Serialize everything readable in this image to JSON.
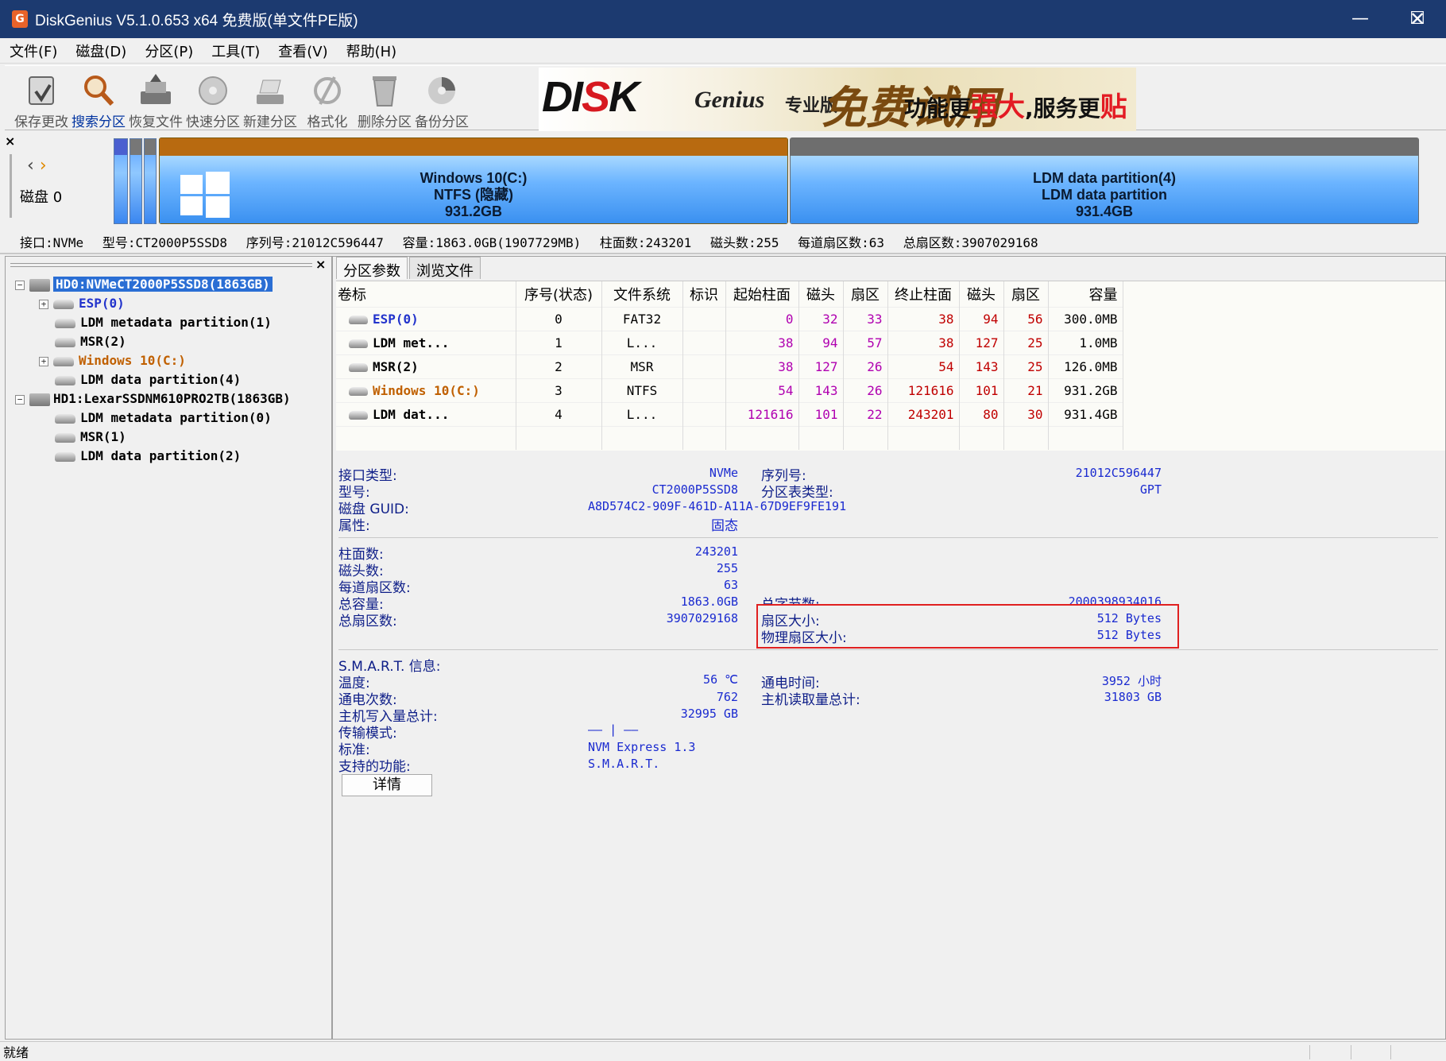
{
  "window": {
    "title": "DiskGenius V5.1.0.653 x64 免费版(单文件PE版)",
    "app_icon": "G"
  },
  "menu": [
    "文件(F)",
    "磁盘(D)",
    "分区(P)",
    "工具(T)",
    "查看(V)",
    "帮助(H)"
  ],
  "toolbar": [
    {
      "label": "保存更改",
      "icon": "save-icon"
    },
    {
      "label": "搜索分区",
      "icon": "search-icon"
    },
    {
      "label": "恢复文件",
      "icon": "recover-icon"
    },
    {
      "label": "快速分区",
      "icon": "quick-partition-icon"
    },
    {
      "label": "新建分区",
      "icon": "new-partition-icon"
    },
    {
      "label": "格式化",
      "icon": "format-icon"
    },
    {
      "label": "删除分区",
      "icon": "delete-icon"
    },
    {
      "label": "备份分区",
      "icon": "backup-icon"
    }
  ],
  "banner": {
    "logo_a": "DI",
    "logo_b": "S",
    "logo_c": "K",
    "genius": "Genius",
    "edition": "专业版",
    "trial": "免费试用",
    "slogan_a": "功能更",
    "slogan_b": "强大",
    "slogan_c": ",服务更",
    "slogan_d": "贴心"
  },
  "diskmap": {
    "disk_label": "磁盘 0",
    "partitions": [
      {
        "line1": "Windows 10(C:)",
        "line2": "NTFS (隐藏)",
        "line3": "931.2GB"
      },
      {
        "line1": "LDM data partition(4)",
        "line2": "LDM data partition",
        "line3": "931.4GB"
      }
    ]
  },
  "diskinfo": {
    "interface": "接口:NVMe",
    "model": "型号:CT2000P5SSD8",
    "serial": "序列号:21012C596447",
    "capacity": "容量:1863.0GB(1907729MB)",
    "cylinders": "柱面数:243201",
    "heads": "磁头数:255",
    "sectors_per_track": "每道扇区数:63",
    "total_sectors": "总扇区数:3907029168"
  },
  "tree": {
    "hd0": "HD0:NVMeCT2000P5SSD8(1863GB)",
    "hd0_items": [
      "ESP(0)",
      "LDM metadata partition(1)",
      "MSR(2)",
      "Windows 10(C:)",
      "LDM data partition(4)"
    ],
    "hd1": "HD1:LexarSSDNM610PRO2TB(1863GB)",
    "hd1_items": [
      "LDM metadata partition(0)",
      "MSR(1)",
      "LDM data partition(2)"
    ]
  },
  "tabs": [
    "分区参数",
    "浏览文件"
  ],
  "table": {
    "columns": [
      "卷标",
      "序号(状态)",
      "文件系统",
      "标识",
      "起始柱面",
      "磁头",
      "扇区",
      "终止柱面",
      "磁头",
      "扇区",
      "容量"
    ],
    "rows": [
      [
        "ESP(0)",
        "0",
        "FAT32",
        "",
        "0",
        "32",
        "33",
        "38",
        "94",
        "56",
        "300.0MB"
      ],
      [
        "LDM met...",
        "1",
        "L...",
        "",
        "38",
        "94",
        "57",
        "38",
        "127",
        "25",
        "1.0MB"
      ],
      [
        "MSR(2)",
        "2",
        "MSR",
        "",
        "38",
        "127",
        "26",
        "54",
        "143",
        "25",
        "126.0MB"
      ],
      [
        "Windows 10(C:)",
        "3",
        "NTFS",
        "",
        "54",
        "143",
        "26",
        "121616",
        "101",
        "21",
        "931.2GB"
      ],
      [
        "LDM dat...",
        "4",
        "L...",
        "",
        "121616",
        "101",
        "22",
        "243201",
        "80",
        "30",
        "931.4GB"
      ]
    ]
  },
  "details": {
    "interface_type_label": "接口类型:",
    "interface_type": "NVMe",
    "serial_label": "序列号:",
    "serial": "21012C596447",
    "model_label": "型号:",
    "model": "CT2000P5SSD8",
    "pt_type_label": "分区表类型:",
    "pt_type": "GPT",
    "guid_label": "磁盘 GUID:",
    "guid": "A8D574C2-909F-461D-A11A-67D9EF9FE191",
    "attr_label": "属性:",
    "attr": "固态",
    "cyl_label": "柱面数:",
    "cyl": "243201",
    "heads_label": "磁头数:",
    "heads": "255",
    "spt_label": "每道扇区数:",
    "spt": "63",
    "cap_label": "总容量:",
    "cap": "1863.0GB",
    "bytes_label": "总字节数:",
    "bytes": "2000398934016",
    "sectors_label": "总扇区数:",
    "sectors": "3907029168",
    "sector_size_label": "扇区大小:",
    "sector_size": "512 Bytes",
    "phys_sector_label": "物理扇区大小:",
    "phys_sector": "512 Bytes",
    "smart_label": "S.M.A.R.T. 信息:",
    "temp_label": "温度:",
    "temp": "56 ℃",
    "power_on_label": "通电时间:",
    "power_on": "3952 小时",
    "power_cycles_label": "通电次数:",
    "power_cycles": "762",
    "host_read_label": "主机读取量总计:",
    "host_read": "31803 GB",
    "host_write_label": "主机写入量总计:",
    "host_write": "32995 GB",
    "transfer_label": "传输模式:",
    "transfer": "—— | ——",
    "standard_label": "标准:",
    "standard": "NVM Express 1.3",
    "features_label": "支持的功能:",
    "features": "S.M.A.R.T.",
    "detail_button": "详情"
  },
  "status": {
    "text": "就绪"
  }
}
